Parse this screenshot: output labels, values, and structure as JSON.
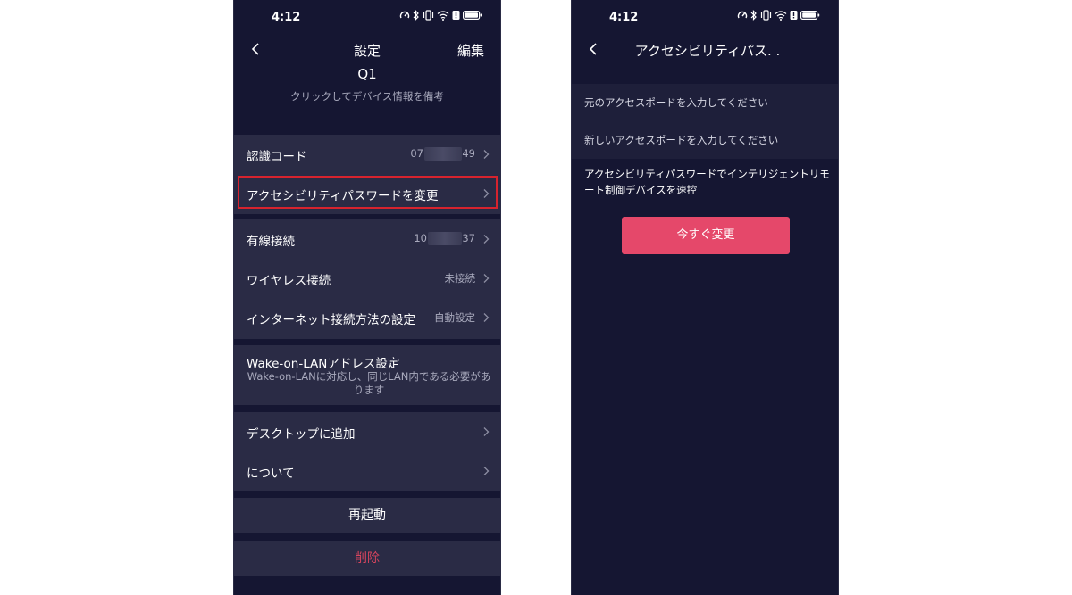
{
  "status_bar": {
    "time": "4:12"
  },
  "settings_screen": {
    "title": "設定",
    "edit_label": "編集",
    "device_name": "Q1",
    "device_note": "クリックしてデバイス情報を備考",
    "groups": {
      "identity": {
        "identification_code": {
          "label": "認識コード",
          "value_start": "07",
          "value_end": "49"
        },
        "change_password": {
          "label": "アクセシビリティパスワードを変更"
        }
      },
      "network": {
        "wired": {
          "label": "有線接続",
          "value_start": "10",
          "value_end": "37"
        },
        "wireless": {
          "label": "ワイヤレス接続",
          "value": "未接続"
        },
        "internet_method": {
          "label": "インターネット接続方法の設定",
          "value": "自動設定"
        }
      },
      "wol": {
        "title": "Wake-on-LANアドレス設定",
        "description": "Wake-on-LANに対応し、同じLAN内である必要があります"
      },
      "misc": {
        "add_desktop": {
          "label": "デスクトップに追加"
        },
        "about": {
          "label": "について"
        }
      }
    },
    "restart_label": "再起動",
    "delete_label": "削除"
  },
  "password_screen": {
    "title": "アクセシビリティパス. .",
    "old_password_placeholder": "元のアクセスポードを入力してください",
    "new_password_placeholder": "新しいアクセスポードを入力してください",
    "hint": "アクセシビリティパスワードでインテリジェントリモート制御デバイスを速控",
    "change_now_label": "今すぐ変更"
  },
  "colors": {
    "background": "#151632",
    "card": "#2a2b45",
    "accent": "#e5486a",
    "danger_text": "#d8455e",
    "highlight_border": "#d7232e"
  }
}
